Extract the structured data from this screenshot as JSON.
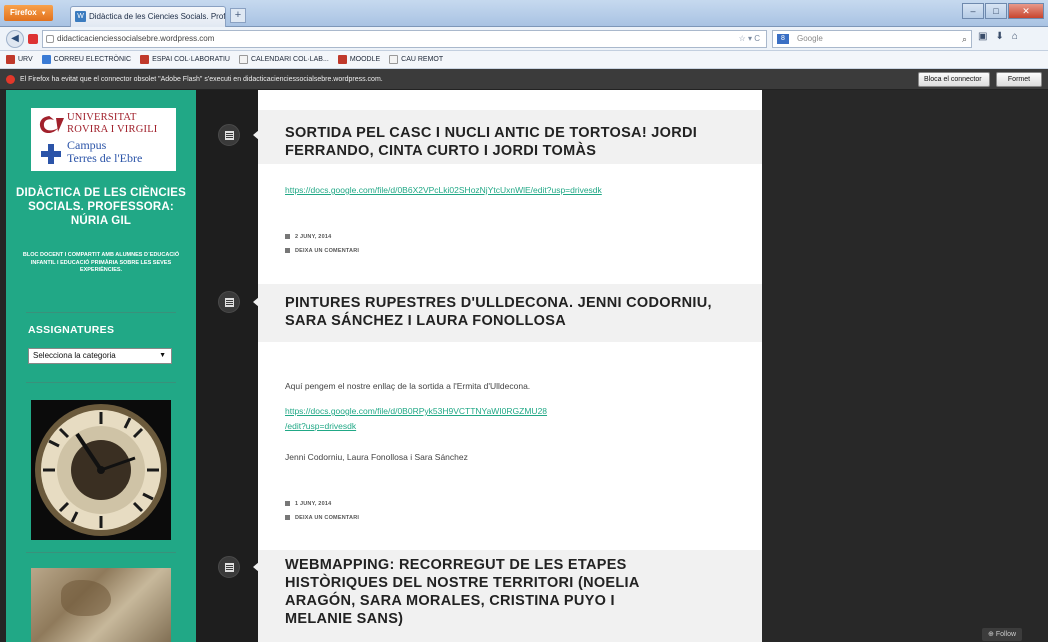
{
  "browser": {
    "app_button": "Firefox",
    "tab_title": "Didàctica de les Ciencies Socials. Profess...",
    "new_tab": "+",
    "url": "didacticacienciessocialsebre.wordpress.com",
    "search_placeholder": "Google",
    "bookmarks": [
      {
        "label": "URV",
        "color": "#c0392b"
      },
      {
        "label": "CORREU ELECTRÒNIC",
        "color": "#3a7bd5"
      },
      {
        "label": "ESPAI COL·LABORATIU",
        "color": "#c0392b"
      },
      {
        "label": "CALENDARI COL·LAB...",
        "color": "#f3f3f3"
      },
      {
        "label": "MOODLE",
        "color": "#c0392b"
      },
      {
        "label": "CAU REMOT",
        "color": "#f3f3f3"
      }
    ],
    "notification": {
      "message": "El Firefox ha evitat que el connector obsolet \"Adobe Flash\" s'executi en didacticacienciessocialsebre.wordpress.com.",
      "block_button": "Bloca el connector",
      "close_button": "Formet"
    }
  },
  "sidebar": {
    "logo": {
      "university_line1": "UNIVERSITAT",
      "university_line2": "ROVIRA I VIRGILI",
      "campus": "Campus",
      "terres": "Terres de l'Ebre"
    },
    "site_title": "DIDÀCTICA DE LES CIÈNCIES SOCIALS. PROFESSORA: NÚRIA GIL",
    "site_description": "BLOC DOCENT I COMPARTIT AMB ALUMNES D´EDUCACIÓ INFANTIL I EDUCACIÓ PRIMÀRIA SOBRE LES SEVES EXPERIÈNCIES.",
    "widget_title": "ASSIGNATURES",
    "category_select": "Selecciona la categoria"
  },
  "posts": [
    {
      "title": "SORTIDA PEL CASC I NUCLI ANTIC DE TORTOSA! JORDI FERRANDO, CINTA CURTO I JORDI TOMÀS",
      "link": "https://docs.google.com/file/d/0B6X2VPcLki02SHozNjYtcUxnWlE/edit?usp=drivesdk",
      "date": "2 JUNY, 2014",
      "comment": "DEIXA UN COMENTARI"
    },
    {
      "title": "PINTURES RUPESTRES D'ULLDECONA. JENNI CODORNIU, SARA SÁNCHEZ I LAURA FONOLLOSA",
      "intro": "Aquí pengem el nostre enllaç de la sortida a l'Ermita d'Ulldecona.",
      "link_line1": "https://docs.google.com/file/d/0B0RPyk53H9VCTTNYaWI0RGZMU28",
      "link_line2": "/edit?usp=drivesdk",
      "authors": "Jenni Codorniu, Laura Fonollosa i Sara Sánchez",
      "date": "1 JUNY, 2014",
      "comment": "DEIXA UN COMENTARI"
    },
    {
      "title": "WEBMAPPING: RECORREGUT DE LES ETAPES HISTÒRIQUES DEL NOSTRE TERRITORI (NOELIA ARAGÓN, SARA MORALES, CRISTINA PUYO I MELANIE SANS)"
    }
  ],
  "follow_button": "Follow",
  "colors": {
    "sidebar_green": "#21a886",
    "link_green": "#21a886",
    "dark_bg": "#252525"
  },
  "icons": [
    "back-arrow-icon",
    "post-format-icon",
    "calendar-icon",
    "comment-icon",
    "warning-icon"
  ]
}
